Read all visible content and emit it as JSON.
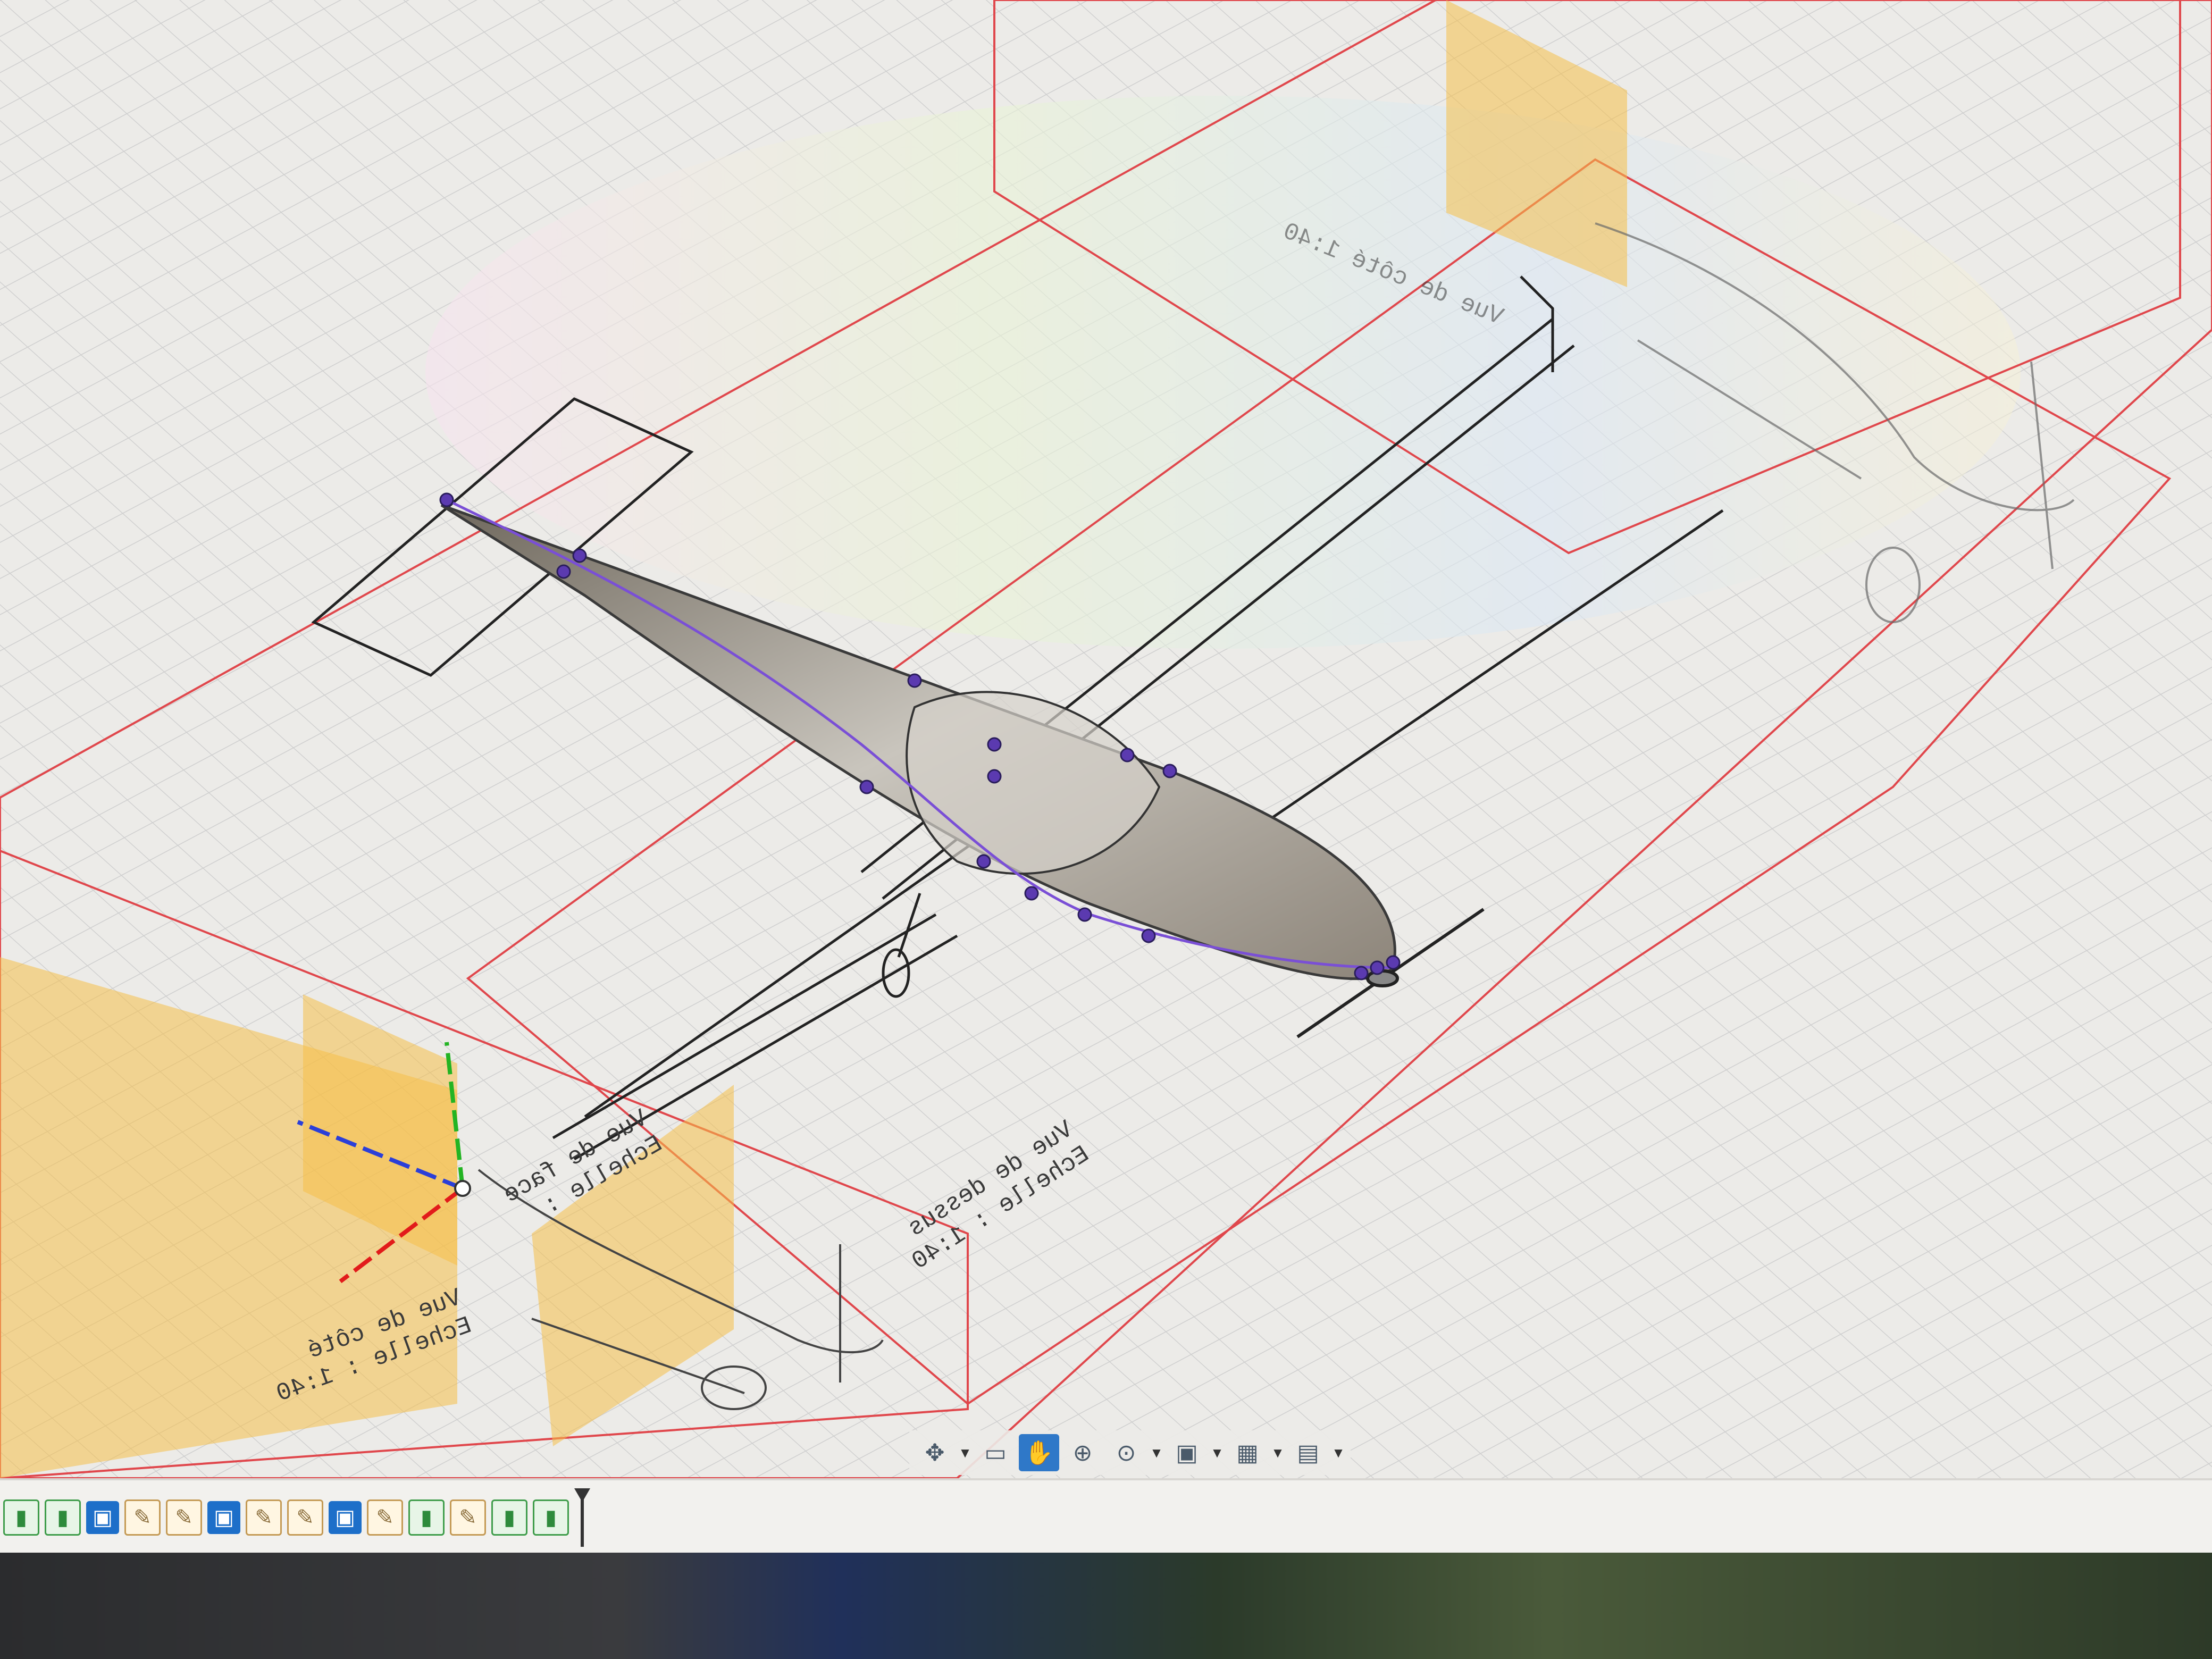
{
  "viewport": {
    "sheets": [
      {
        "id": "top",
        "label_line1": "Vue de dessus",
        "label_line2": "Echelle : 1:40"
      },
      {
        "id": "front",
        "label_line1": "Vue de face",
        "label_line2": "Echelle :"
      },
      {
        "id": "side",
        "label_line1": "Vue de côté",
        "label_line2": "Echelle : 1:40"
      },
      {
        "id": "side-back",
        "label_line1": "Vue de côté 1:40",
        "label_line2": ""
      }
    ],
    "colors": {
      "grid": "#cfcfcf",
      "sheet_border": "#e0474c",
      "canvas_plane": "#f5c048",
      "spline": "#7a4fd6",
      "axis_x": "#e21b1b",
      "axis_y": "#23b423",
      "axis_z": "#2b3fd8",
      "fuselage": "#8c8578"
    }
  },
  "nav_toolbar": {
    "tools": [
      {
        "name": "orbit-icon",
        "glyph": "✥",
        "caret": true,
        "active": false
      },
      {
        "name": "look-at-icon",
        "glyph": "▭",
        "caret": false,
        "active": false
      },
      {
        "name": "pan-icon",
        "glyph": "✋",
        "caret": false,
        "active": true
      },
      {
        "name": "zoom-icon",
        "glyph": "⊕",
        "caret": false,
        "active": false
      },
      {
        "name": "fit-icon",
        "glyph": "⊙",
        "caret": true,
        "active": false
      },
      {
        "name": "display-settings-icon",
        "glyph": "▣",
        "caret": true,
        "active": false
      },
      {
        "name": "grid-settings-icon",
        "glyph": "▦",
        "caret": true,
        "active": false
      },
      {
        "name": "viewports-icon",
        "glyph": "▤",
        "caret": true,
        "active": false
      }
    ]
  },
  "timeline": {
    "features": [
      "extrude",
      "extrude",
      "body",
      "sketch",
      "sketch",
      "body",
      "sketch",
      "sketch",
      "body",
      "sketch",
      "extrude",
      "sketch",
      "extrude",
      "extrude"
    ]
  }
}
